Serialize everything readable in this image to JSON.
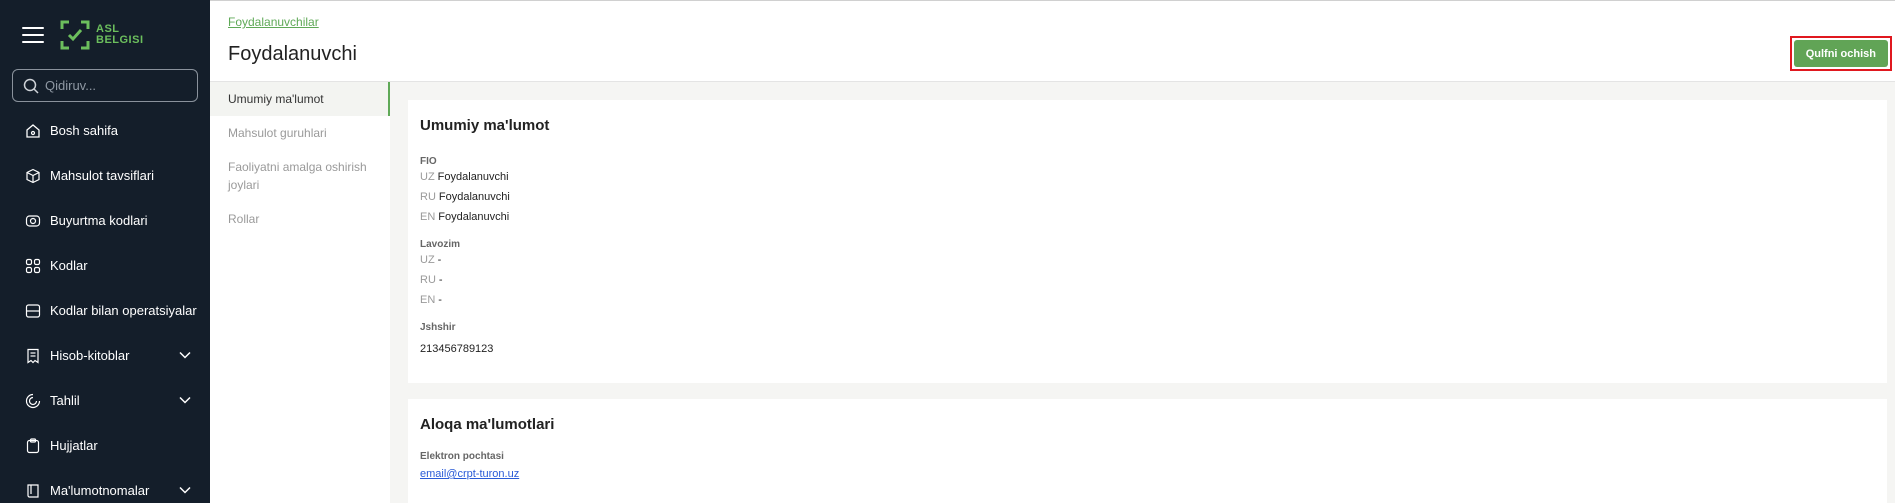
{
  "sidebar": {
    "logo_line1": "ASL",
    "logo_line2": "BELGISI",
    "search_placeholder": "Qidiruv...",
    "items": [
      {
        "label": "Bosh sahifa",
        "icon": "home-icon"
      },
      {
        "label": "Mahsulot tavsiflari",
        "icon": "cube-icon"
      },
      {
        "label": "Buyurtma kodlari",
        "icon": "order-code-icon"
      },
      {
        "label": "Kodlar",
        "icon": "codes-icon"
      },
      {
        "label": "Kodlar bilan operatsiyalar",
        "icon": "operations-icon"
      },
      {
        "label": "Hisob-kitoblar",
        "icon": "reports-icon",
        "expandable": true
      },
      {
        "label": "Tahlil",
        "icon": "analytics-icon",
        "expandable": true
      },
      {
        "label": "Hujjatlar",
        "icon": "documents-icon"
      },
      {
        "label": "Ma'lumotnomalar",
        "icon": "reference-book-icon",
        "expandable": true
      }
    ]
  },
  "header": {
    "breadcrumb": "Foydalanuvchilar",
    "title": "Foydalanuvchi",
    "unlock_button": "Qulfni ochish"
  },
  "subnav": {
    "items": [
      {
        "label": "Umumiy ma'lumot",
        "active": true
      },
      {
        "label": "Mahsulot guruhlari",
        "active": false
      },
      {
        "label": "Faoliyatni amalga oshirish joylari",
        "active": false
      },
      {
        "label": "Rollar",
        "active": false
      }
    ]
  },
  "general": {
    "title": "Umumiy ma'lumot",
    "fio_label": "FIO",
    "fio": {
      "uz_code": "UZ",
      "uz": "Foydalanuvchi",
      "ru_code": "RU",
      "ru": "Foydalanuvchi",
      "en_code": "EN",
      "en": "Foydalanuvchi"
    },
    "position_label": "Lavozim",
    "position": {
      "uz_code": "UZ",
      "uz": "-",
      "ru_code": "RU",
      "ru": "-",
      "en_code": "EN",
      "en": "-"
    },
    "jshshir_label": "Jshshir",
    "jshshir": "213456789123"
  },
  "contact": {
    "title": "Aloqa ma'lumotlari",
    "email_label": "Elektron pochtasi",
    "email": "email@crpt-turon.uz"
  },
  "colors": {
    "sidebar_bg": "#141e2a",
    "accent": "#61a456",
    "highlight_border": "#e0181f"
  }
}
